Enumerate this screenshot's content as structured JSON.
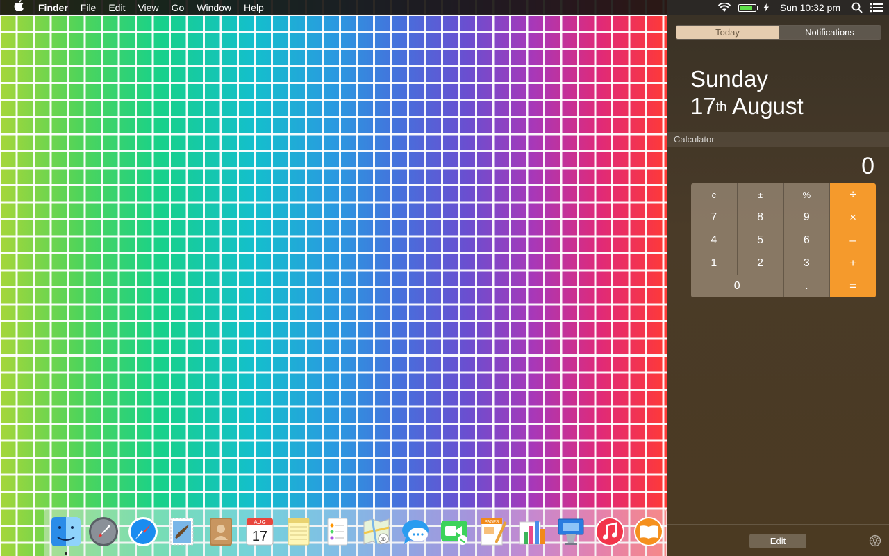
{
  "menubar": {
    "apple_icon": "apple-icon",
    "app_name": "Finder",
    "menus": [
      "File",
      "Edit",
      "View",
      "Go",
      "Window",
      "Help"
    ],
    "clock": "Sun 10:32 pm",
    "battery_level": 0.85
  },
  "notification_center": {
    "tabs": {
      "today": "Today",
      "notifications": "Notifications"
    },
    "date": {
      "weekday": "Sunday",
      "day": "17",
      "ordinal": "th",
      "month": "August"
    },
    "widget_title": "Calculator",
    "calculator": {
      "display": "0",
      "keys": [
        "c",
        "±",
        "%",
        "÷",
        "7",
        "8",
        "9",
        "×",
        "4",
        "5",
        "6",
        "–",
        "1",
        "2",
        "3",
        "+",
        "0",
        ".",
        "="
      ]
    },
    "edit_label": "Edit"
  },
  "dock": {
    "apps": [
      "Finder",
      "Launchpad",
      "Safari",
      "Mail",
      "Contacts",
      "Calendar",
      "Notes",
      "Reminders",
      "Maps",
      "Messages",
      "FaceTime",
      "Pages",
      "Numbers",
      "Keynote",
      "iTunes",
      "iBooks"
    ],
    "calendar_month": "AUG",
    "calendar_day": "17",
    "pages_label": "PAGES"
  },
  "colors": {
    "accent_orange": "#f59a2c",
    "facetime_green": "#3cd35a",
    "itunes_red": "#f2344a"
  }
}
